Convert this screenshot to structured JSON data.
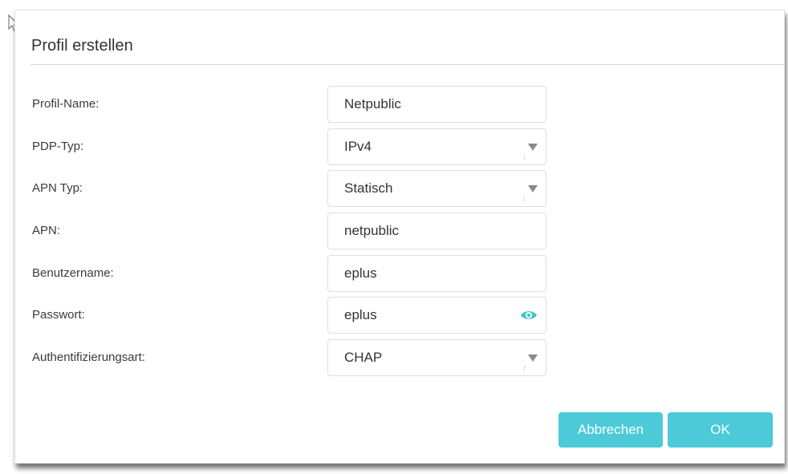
{
  "dialog": {
    "title": "Profil erstellen"
  },
  "form": {
    "profile_name": {
      "label": "Profil-Name:",
      "value": "Netpublic"
    },
    "pdp_type": {
      "label": "PDP-Typ:",
      "value": "IPv4"
    },
    "apn_type": {
      "label": "APN Typ:",
      "value": "Statisch"
    },
    "apn": {
      "label": "APN:",
      "value": "netpublic"
    },
    "username": {
      "label": "Benutzername:",
      "value": "eplus"
    },
    "password": {
      "label": "Passwort:",
      "value": "eplus"
    },
    "auth_type": {
      "label": "Authentifizierungsart:",
      "value": "CHAP"
    }
  },
  "buttons": {
    "cancel_label": "Abbrechen",
    "ok_label": "OK"
  },
  "icons": {
    "dropdown": "chevron-down-icon",
    "password_toggle": "eye-icon",
    "cursor": "mouse-pointer-icon"
  },
  "colors": {
    "accent": "#4ccad8",
    "eye": "#3fc3d3"
  }
}
